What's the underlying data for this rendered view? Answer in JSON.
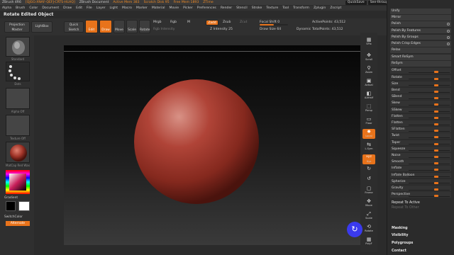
{
  "titlebar": {
    "app": "ZBrush 4R6",
    "id": "[QJGG-XNAF-QEFJ-CRTS-HLHQ]",
    "doc": "ZBrush Document",
    "active_mem": "Active Mem 383",
    "scratch": "Scratch Disk 95",
    "free_mem": "Free Mem 1893",
    "ztime": "ZTime",
    "quicksave": "QuickSave",
    "see_through": "See-through  0",
    "menus": "Menus",
    "script": "DefaultZScript"
  },
  "menubar": [
    "Alpha",
    "Brush",
    "Color",
    "Document",
    "Draw",
    "Edit",
    "File",
    "Layer",
    "Light",
    "Macro",
    "Marker",
    "Material",
    "Movie",
    "Picker",
    "Preferences",
    "Render",
    "Stencil",
    "Stroke",
    "Texture",
    "Tool",
    "Transform",
    "Zplugin",
    "Zscript"
  ],
  "subtitle": "Rotate Edited Object",
  "toolbar": {
    "projection_master": "Projection Master",
    "lightbox": "LightBox",
    "quick_sketch": "Quick Sketch",
    "edit": "Edit",
    "draw": "Draw",
    "move": "Move",
    "scale": "Scale",
    "rotate": "Rotate",
    "mrgb": "Mrgb",
    "rgb": "Rgb",
    "m": "M",
    "rgb_intensity": "Rgb Intensity",
    "zadd": "Zadd",
    "zsub": "Zsub",
    "zcut": "Zcut",
    "z_intensity_label": "Z Intensity",
    "z_intensity": "25",
    "focal_shift_label": "Focal Shift",
    "focal_shift": "0",
    "draw_size_label": "Draw Size",
    "draw_size": "64",
    "dynamic": "Dynamic",
    "active_points": "ActivePoints: 43,512",
    "total_points": "TotalPoints: 43,512"
  },
  "lefttray": {
    "thumbs": [
      "Standard",
      "Dots",
      "Alpha Off",
      "Texture Off",
      "MatCap Red Wax"
    ],
    "gradient": "Gradient",
    "switch_color": "SwitchColor",
    "alternate": "Alternate"
  },
  "shelf": [
    {
      "label": "SPix",
      "icon": "bpr-icon",
      "glyph": "▦",
      "active": false
    },
    {
      "label": "Scroll",
      "icon": "scroll-icon",
      "glyph": "✥",
      "active": false
    },
    {
      "label": "Zoom",
      "icon": "zoom-icon",
      "glyph": "⚲",
      "active": false
    },
    {
      "label": "Actual",
      "icon": "actual-icon",
      "glyph": "▣",
      "active": false
    },
    {
      "label": "AAHalf",
      "icon": "aahalf-icon",
      "glyph": "◧",
      "active": false
    },
    {
      "label": "Persp",
      "icon": "persp-icon",
      "glyph": "⬚",
      "active": false
    },
    {
      "label": "Floor",
      "icon": "floor-icon",
      "glyph": "▭",
      "active": false
    },
    {
      "label": "Local",
      "icon": "local-icon",
      "glyph": "✸",
      "active": true
    },
    {
      "label": "L.Sym",
      "icon": "lsym-icon",
      "glyph": "⇆",
      "active": false
    },
    {
      "label": "Xyz",
      "icon": "xyz-icon",
      "glyph": "xyz",
      "active": true
    },
    {
      "label": "",
      "icon": "rotate-y-icon",
      "glyph": "↻",
      "active": false
    },
    {
      "label": "",
      "icon": "rotate-z-icon",
      "glyph": "↺",
      "active": false
    },
    {
      "label": "Frame",
      "icon": "frame-icon",
      "glyph": "▢",
      "active": false
    },
    {
      "label": "Move",
      "icon": "move-icon",
      "glyph": "✥",
      "active": false
    },
    {
      "label": "Scale",
      "icon": "scale-icon",
      "glyph": "⤢",
      "active": false
    },
    {
      "label": "Rotate",
      "icon": "rotate-icon",
      "glyph": "⟲",
      "active": false
    },
    {
      "label": "PolyF",
      "icon": "polyf-icon",
      "glyph": "▦",
      "active": false
    }
  ],
  "panel": {
    "items": [
      {
        "label": "Unify",
        "kind": "btn"
      },
      {
        "label": "Mirror",
        "kind": "btn"
      },
      {
        "label": "Polish",
        "kind": "dot"
      },
      {
        "label": "Polish By Features",
        "kind": "dot"
      },
      {
        "label": "Polish By Groups",
        "kind": "dot"
      },
      {
        "label": "Polish Crisp Edges",
        "kind": "dot"
      },
      {
        "label": "Relax",
        "kind": "btn"
      },
      {
        "label": "Smart ReSym",
        "kind": "btn"
      },
      {
        "label": "ReSym",
        "kind": "btn"
      },
      {
        "label": "Offset",
        "kind": "sld"
      },
      {
        "label": "Rotate",
        "kind": "sld"
      },
      {
        "label": "Size",
        "kind": "sld"
      },
      {
        "label": "Bend",
        "kind": "sld"
      },
      {
        "label": "SBend",
        "kind": "sld"
      },
      {
        "label": "Skew",
        "kind": "sld"
      },
      {
        "label": "SSkew",
        "kind": "sld"
      },
      {
        "label": "Flatten",
        "kind": "sld"
      },
      {
        "label": "Flatten",
        "kind": "sld"
      },
      {
        "label": "SFlatten",
        "kind": "sld"
      },
      {
        "label": "Twist",
        "kind": "sld"
      },
      {
        "label": "Taper",
        "kind": "sld"
      },
      {
        "label": "Squeeze",
        "kind": "sld"
      },
      {
        "label": "Noise",
        "kind": "sld"
      },
      {
        "label": "Smooth",
        "kind": "sld"
      },
      {
        "label": "Inflate",
        "kind": "sld"
      },
      {
        "label": "Inflate Balloon",
        "kind": "sld"
      },
      {
        "label": "Spherize",
        "kind": "sld"
      },
      {
        "label": "Gravity",
        "kind": "sld"
      },
      {
        "label": "Perspective",
        "kind": "sld"
      }
    ],
    "repeat_to_active": "Repeat To Active",
    "repeat_to_other": "Repeat To Other",
    "sections": [
      "Masking",
      "Visibility",
      "Polygroups",
      "Contact"
    ]
  },
  "colors": {
    "accent": "#e8731b",
    "sphere": "#a83a2c",
    "rotate_button": "#3a3aee"
  }
}
